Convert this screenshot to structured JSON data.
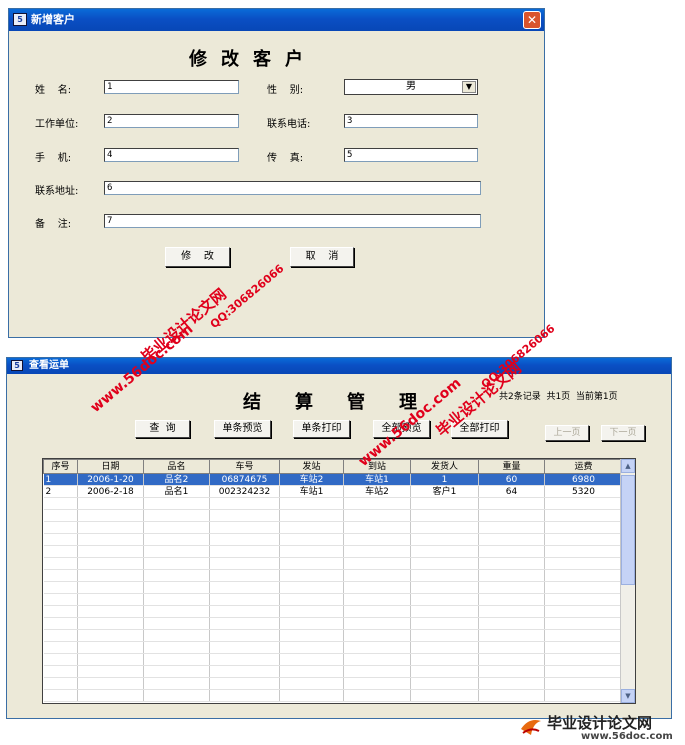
{
  "dialog": {
    "title": "新增客户",
    "close": "✕",
    "heading": "修改客户",
    "fields": {
      "name_label": "姓    名:",
      "name_value": "1",
      "gender_label": "性    别:",
      "gender_value": "男",
      "company_label": "工作单位:",
      "company_value": "2",
      "phone_label": "联系电话:",
      "phone_value": "3",
      "mobile_label": "手    机:",
      "mobile_value": "4",
      "fax_label": "传    真:",
      "fax_value": "5",
      "address_label": "联系地址:",
      "address_value": "6",
      "note_label": "备    注:",
      "note_value": "7"
    },
    "modify_button": "修    改",
    "cancel_button": "取    消"
  },
  "waybill": {
    "title": "查看运单",
    "heading": "结算管理",
    "status": "共2条记录  共1页  当前第1页",
    "buttons": {
      "query": "查  询",
      "single_preview": "单条预览",
      "single_print": "单条打印",
      "all_preview": "全部预览",
      "all_print": "全部打印",
      "prev_page": "上一页",
      "next_page": "下一页"
    },
    "columns": [
      "序号",
      "日期",
      "品名",
      "车号",
      "发站",
      "到站",
      "发货人",
      "重量",
      "运费"
    ],
    "rows": [
      [
        "1",
        "2006-1-20",
        "品名2",
        "06874675",
        "车站2",
        "车站1",
        "1",
        "60",
        "6980"
      ],
      [
        "2",
        "2006-2-18",
        "品名1",
        "002324232",
        "车站1",
        "车站2",
        "客户1",
        "64",
        "5320"
      ]
    ],
    "selected_row": 0
  },
  "watermarks": {
    "site": "www.56doc.com",
    "brand": "毕业设计论文网",
    "qq": "QQ:306826066",
    "footer_brand": "毕业设计论文网",
    "footer_url": "www.56doc.com"
  },
  "colors": {
    "titlebar": "#0a4fc4",
    "window_bg": "#ece9d8",
    "selection": "#316ac5",
    "watermark": "#e0001b"
  }
}
